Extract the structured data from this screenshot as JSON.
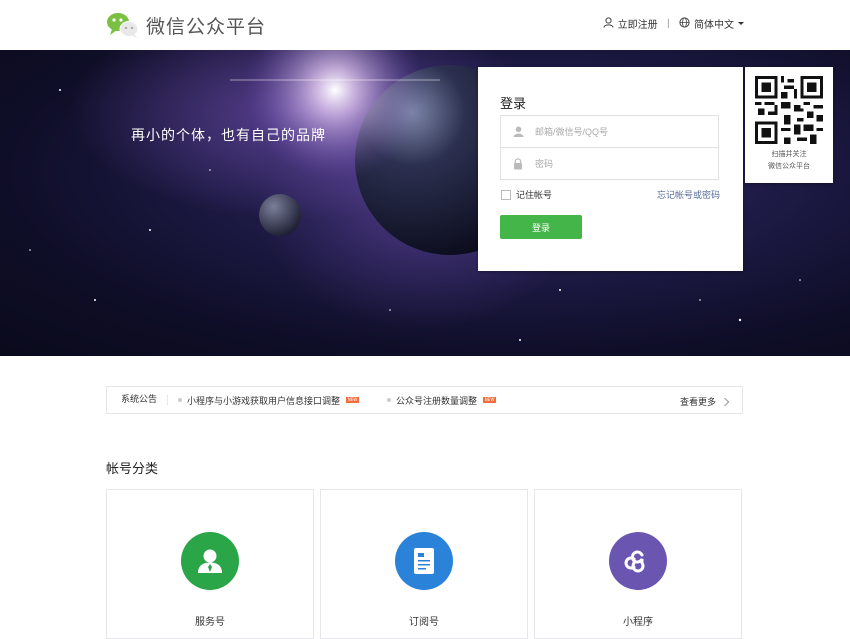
{
  "header": {
    "brand": "微信公众平台",
    "register_label": "立即注册",
    "separator": "|",
    "language_label": "简体中文",
    "icons": [
      "wechat-logo-icon",
      "user-icon",
      "globe-icon",
      "caret-down-icon"
    ]
  },
  "banner": {
    "slogan": "再小的个体，也有自己的品牌"
  },
  "login": {
    "title": "登录",
    "account_placeholder": "邮箱/微信号/QQ号",
    "password_placeholder": "密码",
    "remember_label": "记住帐号",
    "forgot_label": "忘记帐号或密码",
    "submit_label": "登录",
    "colors": {
      "button": "#44b549",
      "link": "#576b95"
    }
  },
  "qr": {
    "line1": "扫描并关注",
    "line2": "微信公众平台"
  },
  "notices": {
    "label": "系统公告",
    "items": [
      {
        "text": "小程序与小游戏获取用户信息接口调整",
        "badge": "NEW"
      },
      {
        "text": "公众号注册数量调整",
        "badge": "NEW"
      }
    ],
    "more_label": "查看更多"
  },
  "categories": {
    "title": "帐号分类",
    "items": [
      {
        "label": "服务号",
        "icon": "service-account-icon",
        "color": "#2aa548"
      },
      {
        "label": "订阅号",
        "icon": "subscription-account-icon",
        "color": "#2b82d9"
      },
      {
        "label": "小程序",
        "icon": "mini-program-icon",
        "color": "#6a55b1"
      }
    ]
  }
}
